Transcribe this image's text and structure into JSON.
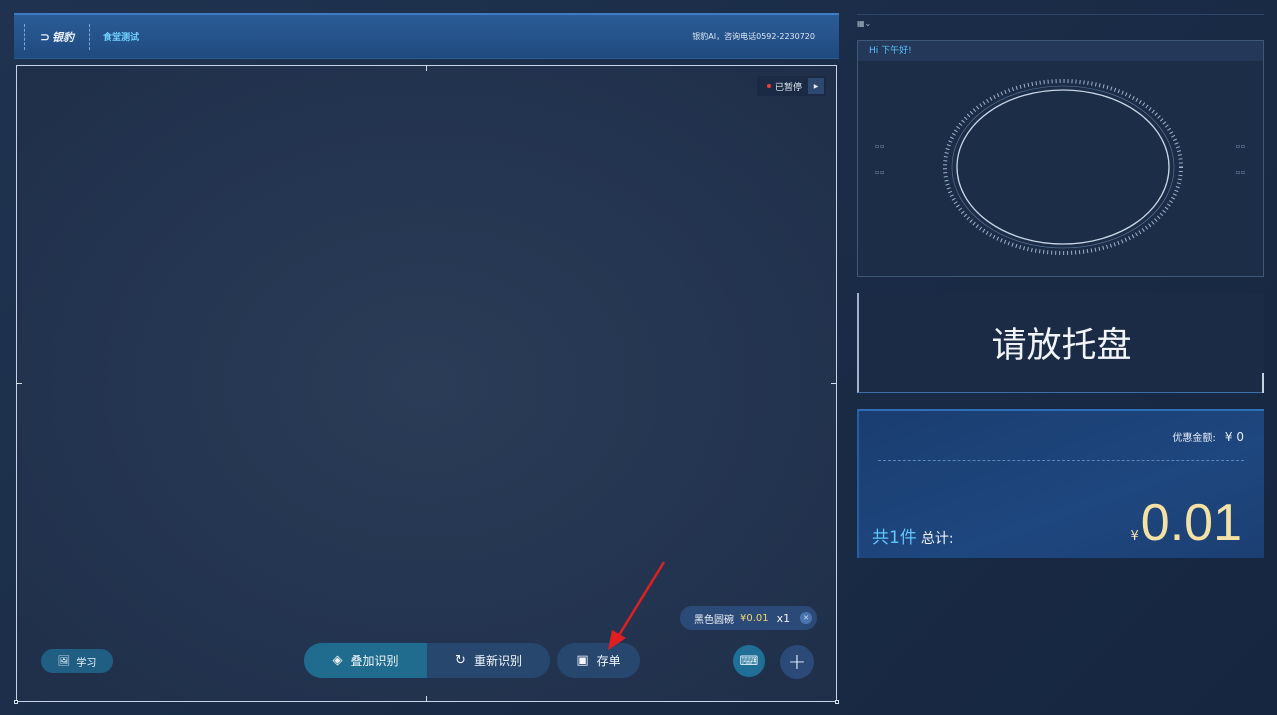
{
  "header": {
    "logo_text": "银豹",
    "store_name": "食堂测试",
    "contact": "银豹AI，咨询电话0592-2230720"
  },
  "camera": {
    "status_text": "已暂停"
  },
  "item_chip": {
    "name": "黑色圆碗",
    "price": "¥0.01",
    "qty": "x1"
  },
  "buttons": {
    "learn": "学习",
    "overlay_recognize": "叠加识别",
    "re_recognize": "重新识别",
    "save_order": "存单"
  },
  "right": {
    "greeting": "Hi 下午好!",
    "status_message": "请放托盘",
    "discount_label": "优惠金额:",
    "discount_amount": "¥ 0",
    "count_text": "共1件",
    "total_label": "总计:",
    "currency": "¥",
    "total_amount": "0.01"
  },
  "colors": {
    "accent_cyan": "#58c2ff",
    "price_gold": "#f4e2a5",
    "arrow_red": "#e02020"
  }
}
